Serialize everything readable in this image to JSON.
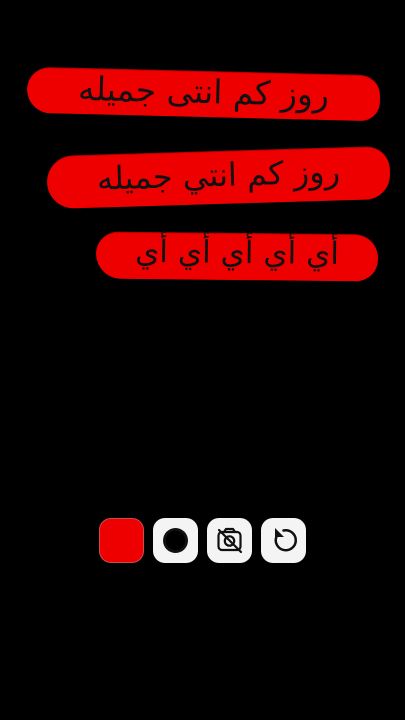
{
  "colors": {
    "accent": "#ee0000",
    "background": "#000000",
    "button_bg": "#f4f4f4",
    "ink": "#111111"
  },
  "annotations": [
    {
      "text": "روز كم انتى جميله"
    },
    {
      "text": "روز كم انتي جميله"
    },
    {
      "text": "أي أي أي أي أي"
    }
  ],
  "toolbar": {
    "buttons": [
      {
        "icon": "color-swatch-icon"
      },
      {
        "icon": "record-icon"
      },
      {
        "icon": "camera-off-icon"
      },
      {
        "icon": "undo-icon"
      }
    ]
  }
}
